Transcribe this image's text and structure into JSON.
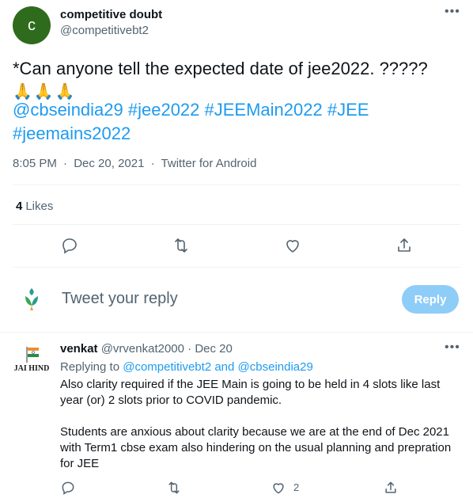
{
  "tweet": {
    "avatar_letter": "c",
    "author_name": "competitive doubt",
    "author_handle": "@competitivebt2",
    "text": "*Can anyone tell the expected date of jee2022. ?????",
    "emoji": "🙏🙏🙏",
    "hashtags_line1": "@cbseindia29 #jee2022 #JEEMain2022 #JEE",
    "hashtags_line2": "#jeemains2022",
    "time": "8:05 PM",
    "date": "Dec 20, 2021",
    "source": "Twitter for Android",
    "likes_count": "4",
    "likes_label": "Likes",
    "more": "•••"
  },
  "reply_box": {
    "placeholder": "Tweet your reply",
    "button_label": "Reply"
  },
  "reply": {
    "avatar_text": "JAI HIND",
    "author_name": "venkat",
    "author_handle": "@vrvenkat2000",
    "date": "Dec 20",
    "replying_prefix": "Replying to",
    "replying_user1": "@competitivebt2",
    "replying_and": "and",
    "replying_user2": "@cbseindia29",
    "paragraph1": "Also clarity required if the JEE Main is going to be held in 4 slots like last year (or) 2 slots prior to COVID pandemic.",
    "paragraph2": "Students are anxious about clarity because we are at the end of Dec 2021 with Term1 cbse exam also hindering on the usual planning and prepration for JEE",
    "like_count": "2",
    "more": "•••"
  },
  "colors": {
    "accent": "#1d9bf0",
    "muted": "#536471",
    "reply_button_disabled": "#8ecdf8",
    "avatar_bg": "#2e6b1c"
  },
  "icons": [
    "reply-icon",
    "retweet-icon",
    "like-icon",
    "share-icon",
    "more-icon",
    "verified-user-avatar-icon"
  ]
}
